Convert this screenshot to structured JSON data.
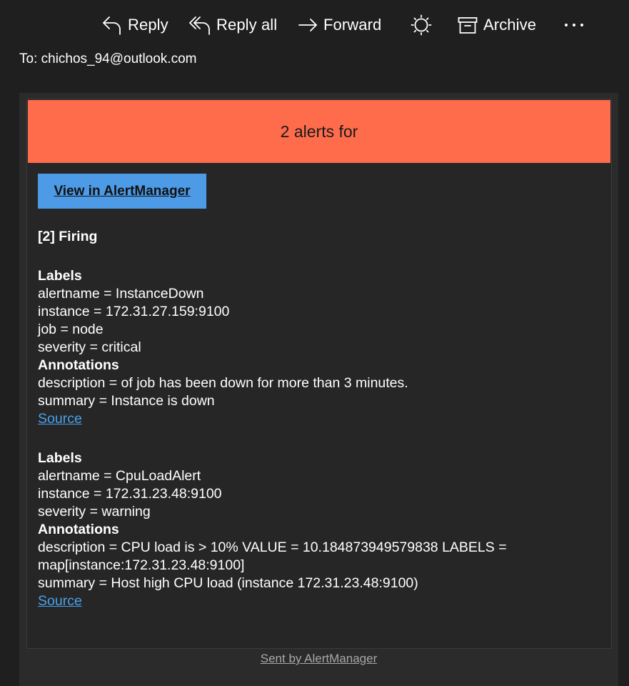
{
  "toolbar": {
    "reply_label": "Reply",
    "reply_all_label": "Reply all",
    "forward_label": "Forward",
    "archive_label": "Archive"
  },
  "recipient": "To: chichos_94@outlook.com",
  "email": {
    "header_text": "2 alerts for",
    "view_button": "View in AlertManager",
    "firing_heading": "[2] Firing",
    "alerts": [
      {
        "labels_heading": "Labels",
        "labels": [
          "alertname = InstanceDown",
          "instance = 172.31.27.159:9100",
          "job = node",
          "severity = critical"
        ],
        "annotations_heading": "Annotations",
        "annotations": [
          "description = of job has been down for more than 3 minutes.",
          "summary = Instance is down"
        ],
        "source_link": "Source"
      },
      {
        "labels_heading": "Labels",
        "labels": [
          "alertname = CpuLoadAlert",
          "instance = 172.31.23.48:9100",
          "severity = warning"
        ],
        "annotations_heading": "Annotations",
        "annotations": [
          "description = CPU load is > 10% VALUE = 10.184873949579838 LABELS = map[instance:172.31.23.48:9100]",
          "summary = Host high CPU load (instance 172.31.23.48:9100)"
        ],
        "source_link": "Source"
      }
    ],
    "footer": "Sent by AlertManager"
  },
  "colors": {
    "header_bar": "#ff6c4c",
    "view_button": "#4d9be6",
    "link": "#4aa0ea"
  }
}
